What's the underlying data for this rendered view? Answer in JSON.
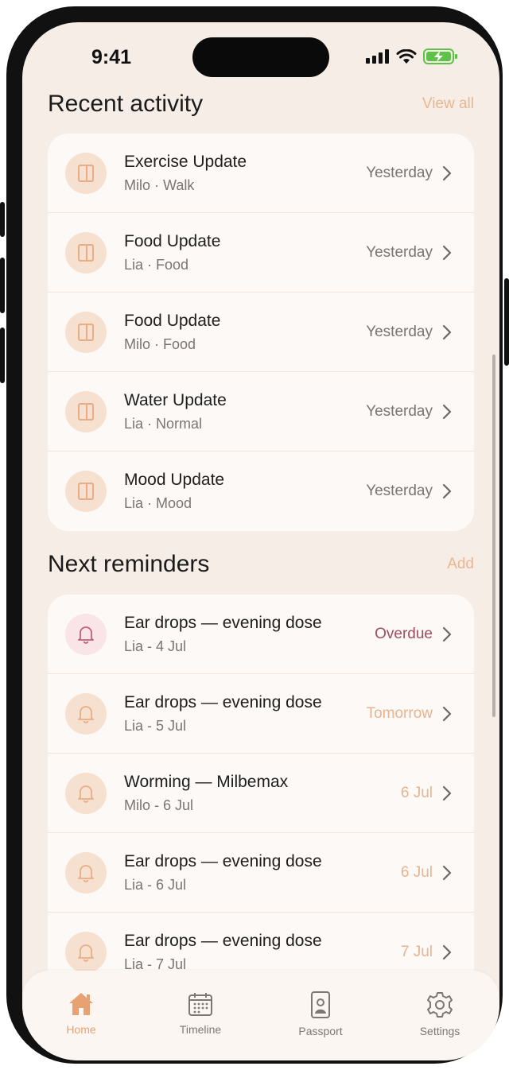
{
  "status_bar": {
    "time": "9:41"
  },
  "recent": {
    "title": "Recent activity",
    "action": "View all",
    "items": [
      {
        "title": "Exercise Update",
        "subtitle": "Milo · Walk",
        "when": "Yesterday"
      },
      {
        "title": "Food Update",
        "subtitle": "Lia · Food",
        "when": "Yesterday"
      },
      {
        "title": "Food Update",
        "subtitle": "Milo · Food",
        "when": "Yesterday"
      },
      {
        "title": "Water Update",
        "subtitle": "Lia · Normal",
        "when": "Yesterday"
      },
      {
        "title": "Mood Update",
        "subtitle": "Lia · Mood",
        "when": "Yesterday"
      }
    ]
  },
  "reminders": {
    "title": "Next reminders",
    "action": "Add",
    "items": [
      {
        "title": "Ear drops — evening dose",
        "subtitle": "Lia - 4 Jul",
        "when": "Overdue",
        "status": "overdue"
      },
      {
        "title": "Ear drops — evening dose",
        "subtitle": "Lia - 5 Jul",
        "when": "Tomorrow",
        "status": "soon"
      },
      {
        "title": "Worming — Milbemax",
        "subtitle": "Milo - 6 Jul",
        "when": "6 Jul",
        "status": "soon"
      },
      {
        "title": "Ear drops — evening dose",
        "subtitle": "Lia - 6 Jul",
        "when": "6 Jul",
        "status": "soon"
      },
      {
        "title": "Ear drops — evening dose",
        "subtitle": "Lia - 7 Jul",
        "when": "7 Jul",
        "status": "soon"
      }
    ]
  },
  "tabbar": {
    "tabs": [
      {
        "label": "Home",
        "icon": "home-icon",
        "active": true
      },
      {
        "label": "Timeline",
        "icon": "calendar-icon",
        "active": false
      },
      {
        "label": "Passport",
        "icon": "passport-icon",
        "active": false
      },
      {
        "label": "Settings",
        "icon": "gear-icon",
        "active": false
      }
    ]
  },
  "colors": {
    "accent": "#e7a172",
    "overdue": "#a24a65",
    "background": "#f6ede6",
    "card": "#fcf9f6"
  }
}
